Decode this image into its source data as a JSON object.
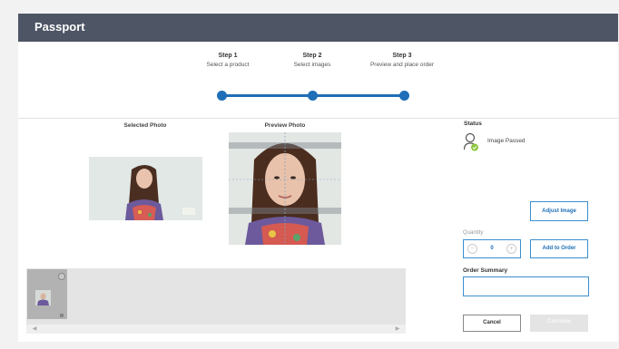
{
  "app": {
    "title": "Passport"
  },
  "steps": [
    {
      "number": "Step 1",
      "description": "Select a product"
    },
    {
      "number": "Step 2",
      "description": "Select images"
    },
    {
      "number": "Step 3",
      "description": "Preview and place order"
    }
  ],
  "photos": {
    "selected_label": "Selected Photo",
    "preview_label": "Preview Photo"
  },
  "status": {
    "label": "Status",
    "text": "Image Passed",
    "icon": "user-check-icon",
    "icon_color": "#8dc63f"
  },
  "actions": {
    "adjust_label": "Adjust Image",
    "quantity_label": "Quantity",
    "quantity_value": "0",
    "decrement_symbol": "−",
    "increment_symbol": "+",
    "add_label": "Add to Order",
    "order_summary_label": "Order Summary",
    "order_summary_value": "",
    "cancel_label": "Cancel",
    "continue_label": "Continue"
  },
  "colors": {
    "header": "#4e5565",
    "accent": "#1e6fb7"
  }
}
